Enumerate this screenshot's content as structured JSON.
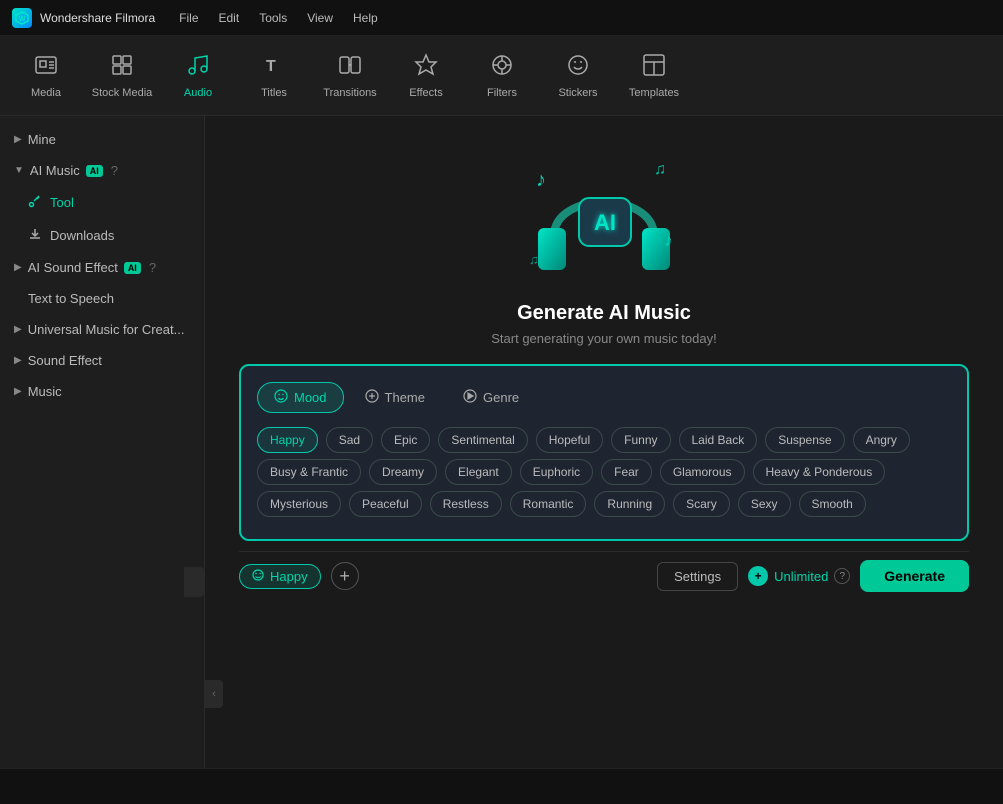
{
  "app": {
    "name": "Wondershare Filmora",
    "logo_text": "W"
  },
  "menu": {
    "items": [
      "File",
      "Edit",
      "Tools",
      "View",
      "Help"
    ]
  },
  "toolbar": {
    "items": [
      {
        "id": "media",
        "label": "Media",
        "icon": "🎬"
      },
      {
        "id": "stock-media",
        "label": "Stock Media",
        "icon": "📷"
      },
      {
        "id": "audio",
        "label": "Audio",
        "icon": "🎵"
      },
      {
        "id": "titles",
        "label": "Titles",
        "icon": "T"
      },
      {
        "id": "transitions",
        "label": "Transitions",
        "icon": "⧉"
      },
      {
        "id": "effects",
        "label": "Effects",
        "icon": "✨"
      },
      {
        "id": "filters",
        "label": "Filters",
        "icon": "⊙"
      },
      {
        "id": "stickers",
        "label": "Stickers",
        "icon": "🙂"
      },
      {
        "id": "templates",
        "label": "Templates",
        "icon": "▦"
      }
    ],
    "active": "audio"
  },
  "sidebar": {
    "sections": [
      {
        "id": "mine",
        "label": "Mine",
        "expanded": false,
        "children": []
      },
      {
        "id": "ai-music",
        "label": "AI Music",
        "has_ai_badge": true,
        "has_help": true,
        "expanded": true,
        "children": [
          {
            "id": "tool",
            "label": "Tool",
            "icon": "🔧",
            "active": true
          },
          {
            "id": "downloads",
            "label": "Downloads",
            "icon": "⬇"
          }
        ]
      },
      {
        "id": "ai-sound-effect",
        "label": "AI Sound Effect",
        "has_ai_badge": true,
        "has_help": true,
        "expanded": false,
        "children": []
      },
      {
        "id": "text-to-speech",
        "label": "Text to Speech",
        "expanded": false,
        "children": [],
        "indent": true
      },
      {
        "id": "universal-music",
        "label": "Universal Music for Creat...",
        "expanded": false,
        "children": []
      },
      {
        "id": "sound-effect",
        "label": "Sound Effect",
        "expanded": false,
        "children": []
      },
      {
        "id": "music",
        "label": "Music",
        "expanded": false,
        "children": []
      }
    ]
  },
  "ai_music": {
    "title": "Generate AI Music",
    "subtitle": "Start generating your own music today!",
    "tabs": [
      {
        "id": "mood",
        "label": "Mood",
        "icon": "😊",
        "active": true
      },
      {
        "id": "theme",
        "label": "Theme",
        "icon": "🎭",
        "active": false
      },
      {
        "id": "genre",
        "label": "Genre",
        "icon": "🎸",
        "active": false
      }
    ],
    "mood_tags_row1": [
      {
        "id": "happy",
        "label": "Happy",
        "active": true
      },
      {
        "id": "sad",
        "label": "Sad"
      },
      {
        "id": "epic",
        "label": "Epic"
      },
      {
        "id": "sentimental",
        "label": "Sentimental"
      },
      {
        "id": "hopeful",
        "label": "Hopeful"
      },
      {
        "id": "funny",
        "label": "Funny"
      },
      {
        "id": "laid-back",
        "label": "Laid Back"
      },
      {
        "id": "suspense",
        "label": "Suspense"
      },
      {
        "id": "angry",
        "label": "Angry"
      }
    ],
    "mood_tags_row2": [
      {
        "id": "busy-frantic",
        "label": "Busy & Frantic"
      },
      {
        "id": "dreamy",
        "label": "Dreamy"
      },
      {
        "id": "elegant",
        "label": "Elegant"
      },
      {
        "id": "euphoric",
        "label": "Euphoric"
      },
      {
        "id": "fear",
        "label": "Fear"
      },
      {
        "id": "glamorous",
        "label": "Glamorous"
      },
      {
        "id": "heavy-ponderous",
        "label": "Heavy & Ponderous"
      }
    ],
    "mood_tags_row3": [
      {
        "id": "mysterious",
        "label": "Mysterious"
      },
      {
        "id": "peaceful",
        "label": "Peaceful"
      },
      {
        "id": "restless",
        "label": "Restless"
      },
      {
        "id": "romantic",
        "label": "Romantic"
      },
      {
        "id": "running",
        "label": "Running"
      },
      {
        "id": "scary",
        "label": "Scary"
      },
      {
        "id": "sexy",
        "label": "Sexy"
      },
      {
        "id": "smooth",
        "label": "Smooth"
      }
    ]
  },
  "bottom_bar": {
    "selected_tag": "Happy",
    "selected_tag_icon": "😊",
    "add_label": "+",
    "settings_label": "Settings",
    "unlimited_label": "Unlimited",
    "help_label": "?",
    "generate_label": "Generate"
  },
  "status_bar": {
    "text": ""
  }
}
